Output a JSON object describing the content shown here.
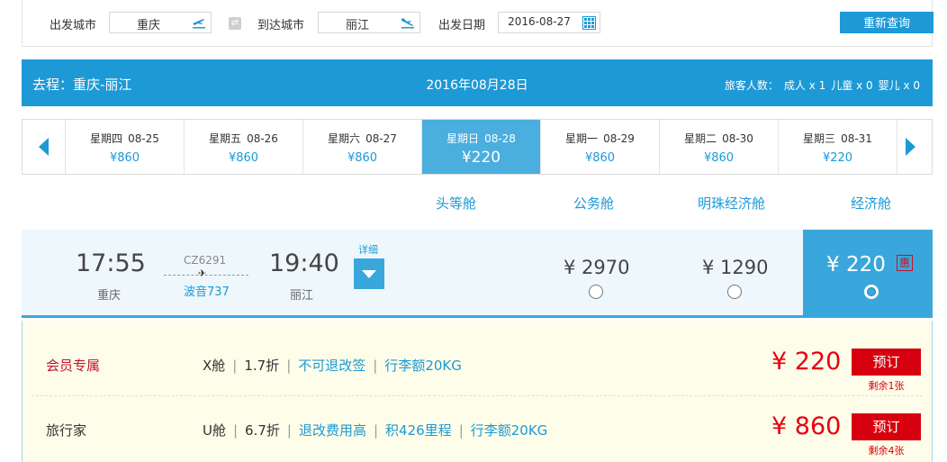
{
  "search": {
    "from_label": "出发城市",
    "from_value": "重庆",
    "to_label": "到达城市",
    "to_value": "丽江",
    "date_label": "出发日期",
    "date_value": "2016-08-27",
    "search_button": "重新查询"
  },
  "route": {
    "title": "去程：重庆-丽江",
    "date": "2016年08月28日",
    "passengers_label": "旅客人数：",
    "adult": "成人 x 1",
    "child": "儿童 x 0",
    "infant": "婴儿 x 0"
  },
  "dates": [
    {
      "weekday": "星期四",
      "date": "08-25",
      "price": "¥860"
    },
    {
      "weekday": "星期五",
      "date": "08-26",
      "price": "¥860"
    },
    {
      "weekday": "星期六",
      "date": "08-27",
      "price": "¥860"
    },
    {
      "weekday": "星期日",
      "date": "08-28",
      "price": "¥220"
    },
    {
      "weekday": "星期一",
      "date": "08-29",
      "price": "¥860"
    },
    {
      "weekday": "星期二",
      "date": "08-30",
      "price": "¥860"
    },
    {
      "weekday": "星期三",
      "date": "08-31",
      "price": "¥220"
    }
  ],
  "active_date_index": 3,
  "cabins": {
    "first": "头等舱",
    "business": "公务舱",
    "pearl_economy": "明珠经济舱",
    "economy": "经济舱"
  },
  "flight": {
    "dep_time": "17:55",
    "dep_city": "重庆",
    "flight_no": "CZ6291",
    "plane_type": "波音737",
    "arr_time": "19:40",
    "arr_city": "丽江",
    "detail_label": "详细",
    "price_first": "¥ 2970",
    "price_business": "¥ 1290",
    "price_economy": "¥ 220",
    "discount_badge": "惠"
  },
  "fares": [
    {
      "name": "会员专属",
      "cabin": "X舱",
      "discount": "1.7折",
      "rule": "不可退改签",
      "baggage": "行李额20KG",
      "price": "¥ 220",
      "book": "预订",
      "remaining": "剩余1张"
    },
    {
      "name": "旅行家",
      "cabin": "U舱",
      "discount": "6.7折",
      "rule": "退改费用高",
      "mileage": "积426里程",
      "baggage": "行李额20KG",
      "price": "¥ 860",
      "book": "预订",
      "remaining": "剩余4张"
    }
  ],
  "colors": {
    "brand_blue": "#1d99d6",
    "active_blue": "#4aaedf",
    "book_red": "#d7000f",
    "price_red": "#e60012",
    "fare_bg": "#fefde9"
  }
}
